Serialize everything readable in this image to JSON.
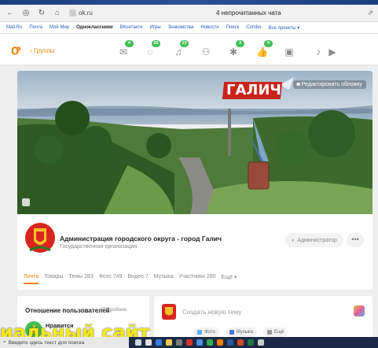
{
  "browser": {
    "url": "ok.ru",
    "tab_title": "4 непрочитанных чата"
  },
  "portal": {
    "items": [
      "Mail.Ru",
      "Почта",
      "Мой Мир",
      "Одноклассники",
      "ВКонтакте",
      "Игры",
      "Знакомства",
      "Новости",
      "Поиск",
      "Combo",
      "Все проекты ▾"
    ],
    "active_index": 3
  },
  "toolbar": {
    "back_label": "Группы",
    "badges": {
      "messages": "4",
      "discussions": "56",
      "notifications": "23",
      "guests": "3",
      "events": "9"
    }
  },
  "cover": {
    "edit_label": "Редактировать обложку",
    "sign_text": "ГАЛИЧ"
  },
  "group": {
    "name": "Администрация городского округа - город Галич",
    "type": "Государственная организация",
    "admin_button": "Администратор",
    "more_button": "•••",
    "tabs": [
      "Лента",
      "Товары",
      "Темы 283",
      "Фото 749",
      "Видео 7",
      "Музыка",
      "Участники 280",
      "Ещё ▾"
    ]
  },
  "attitude": {
    "title": "Отношение пользователей",
    "more_link": "Подробнее",
    "like_label": "Нравится"
  },
  "composer": {
    "placeholder": "Создать новую тему",
    "chips": [
      "Фото",
      "Музыка",
      "Ещё"
    ]
  },
  "overlay_caption": "иальный сайт",
  "taskbar": {
    "search_placeholder": "Введите здесь текст для поиска"
  },
  "colors": {
    "accent": "#ee8208",
    "badge": "#3fbf55",
    "caption": "#f4e81e",
    "frame": "#2a4a8a"
  }
}
